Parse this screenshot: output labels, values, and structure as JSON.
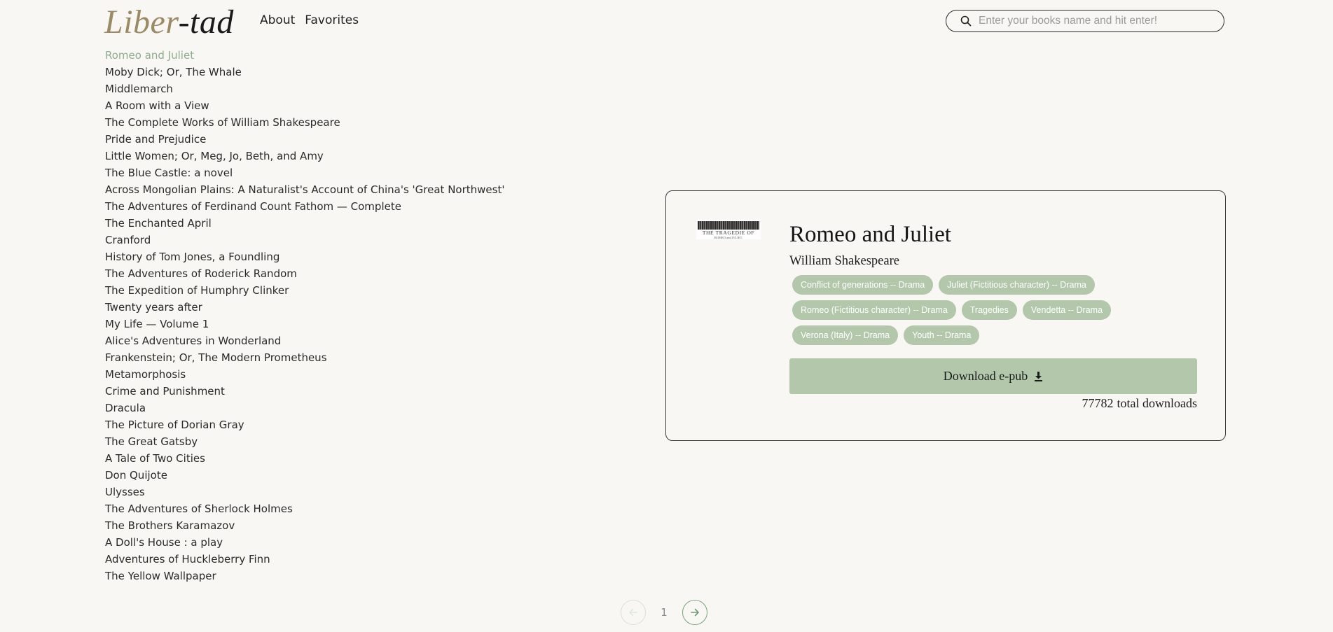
{
  "header": {
    "logo_part1": "Liber",
    "logo_part2": "-tad",
    "nav": {
      "about": "About",
      "favorites": "Favorites"
    },
    "search": {
      "placeholder": "Enter your books name and hit enter!",
      "value": ""
    }
  },
  "books": [
    "Romeo and Juliet",
    "Moby Dick; Or, The Whale",
    "Middlemarch",
    "A Room with a View",
    "The Complete Works of William Shakespeare",
    "Pride and Prejudice",
    "Little Women; Or, Meg, Jo, Beth, and Amy",
    "The Blue Castle: a novel",
    "Across Mongolian Plains: A Naturalist's Account of China's 'Great Northwest'",
    "The Adventures of Ferdinand Count Fathom — Complete",
    "The Enchanted April",
    "Cranford",
    "History of Tom Jones, a Foundling",
    "The Adventures of Roderick Random",
    "The Expedition of Humphry Clinker",
    "Twenty years after",
    "My Life — Volume 1",
    "Alice's Adventures in Wonderland",
    "Frankenstein; Or, The Modern Prometheus",
    "Metamorphosis",
    "Crime and Punishment",
    "Dracula",
    "The Picture of Dorian Gray",
    "The Great Gatsby",
    "A Tale of Two Cities",
    "Don Quijote",
    "Ulysses",
    "The Adventures of Sherlock Holmes",
    "The Brothers Karamazov",
    "A Doll's House : a play",
    "Adventures of Huckleberry Finn",
    "The Yellow Wallpaper"
  ],
  "active_book": "Romeo and Juliet",
  "detail": {
    "cover_text_line1": "THE TRAGEDIE OF",
    "cover_text_line2": "ROMEO and IVLIET.",
    "title": "Romeo and Juliet",
    "author": "William Shakespeare",
    "tags": [
      "Conflict of generations -- Drama",
      "Juliet (Fictitious character) -- Drama",
      "Romeo (Fictitious character) -- Drama",
      "Tragedies",
      "Vendetta -- Drama",
      "Verona (Italy) -- Drama",
      "Youth -- Drama"
    ],
    "download_label": "Download e-pub",
    "download_count": "77782",
    "download_suffix": "total downloads"
  },
  "pagination": {
    "current_page": "1"
  },
  "colors": {
    "background": "#f8f7f3",
    "accent_green": "#b3c8ab",
    "active_link": "#8fad8d",
    "logo_gold": "#9b8a64"
  },
  "icons": {
    "search": "search-icon",
    "download": "download-icon",
    "prev": "arrow-left-icon",
    "next": "arrow-right-icon"
  }
}
